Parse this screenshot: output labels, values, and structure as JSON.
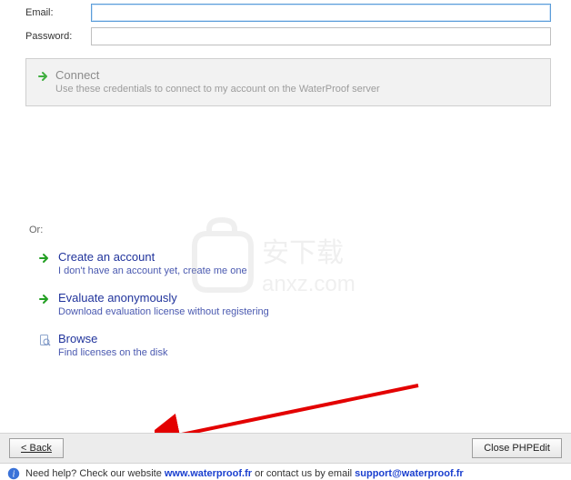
{
  "form": {
    "email_label": "Email:",
    "email_value": "",
    "password_label": "Password:",
    "password_value": ""
  },
  "connect": {
    "title": "Connect",
    "subtitle": "Use these credentials to connect to my account on the WaterProof server"
  },
  "or_label": "Or:",
  "actions": {
    "create": {
      "title": "Create an account",
      "subtitle": "I don't have an account yet, create me one"
    },
    "evaluate": {
      "title": "Evaluate anonymously",
      "subtitle": "Download evaluation license without registering"
    },
    "browse": {
      "title": "Browse",
      "subtitle": "Find licenses on the disk"
    }
  },
  "footer": {
    "back_label": "< Back",
    "close_label": "Close PHPEdit"
  },
  "help": {
    "prefix": "Need help? Check our website ",
    "site": "www.waterproof.fr",
    "mid": " or contact us by email ",
    "email": "support@waterproof.fr"
  },
  "watermark": {
    "text1": "安下载",
    "text2": "anxz.com"
  }
}
